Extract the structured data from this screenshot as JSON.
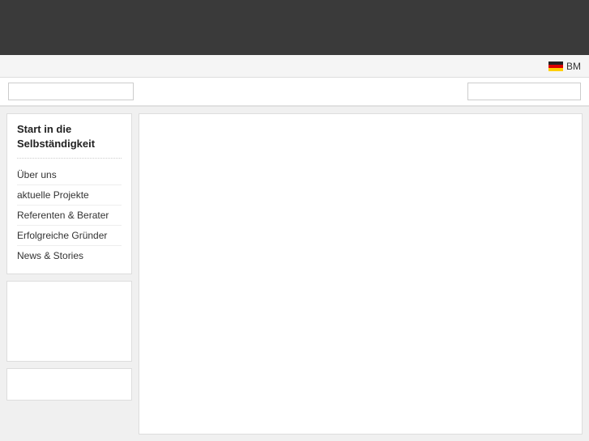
{
  "header": {
    "bg_color": "#3a3a3a"
  },
  "sub_header": {
    "lang_label": "BM",
    "flag": "de"
  },
  "nav": {
    "search_placeholder": "",
    "search_right_placeholder": ""
  },
  "sidebar": {
    "nav_title_line1": "Start in die",
    "nav_title_line2": "Selbständigkeit",
    "items": [
      {
        "label": "Über uns"
      },
      {
        "label": "aktuelle Projekte"
      },
      {
        "label": "Referenten & Berater"
      },
      {
        "label": "Erfolgreiche Gründer"
      },
      {
        "label": "News & Stories"
      }
    ]
  },
  "news_stories_label": "News Stories"
}
